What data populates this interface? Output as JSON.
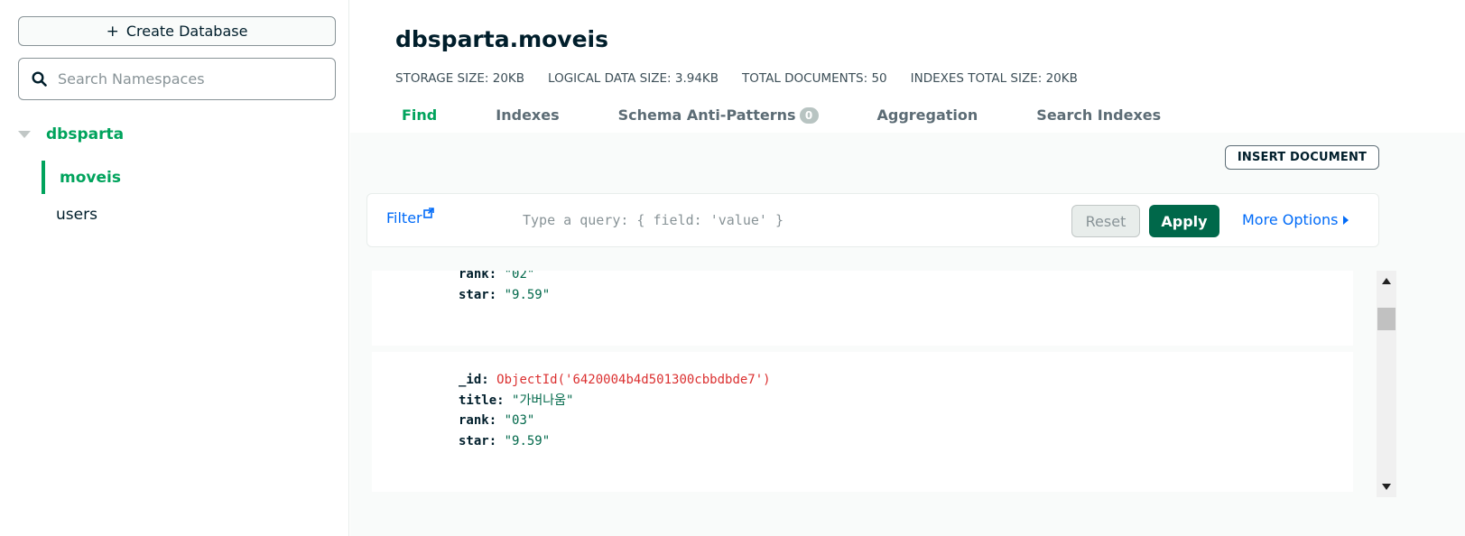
{
  "sidebar": {
    "create_database_icon": "+",
    "create_database_label": "Create Database",
    "search_placeholder": "Search Namespaces",
    "database": "dbsparta",
    "collections": [
      {
        "label": "moveis",
        "active": true
      },
      {
        "label": "users",
        "active": false
      }
    ]
  },
  "header": {
    "title": "dbsparta.moveis",
    "stats": [
      {
        "label": "STORAGE SIZE:",
        "value": "20KB"
      },
      {
        "label": "LOGICAL DATA SIZE:",
        "value": "3.94KB"
      },
      {
        "label": "TOTAL DOCUMENTS:",
        "value": "50"
      },
      {
        "label": "INDEXES TOTAL SIZE:",
        "value": "20KB"
      }
    ],
    "tabs": [
      {
        "label": "Find",
        "active": true
      },
      {
        "label": "Indexes"
      },
      {
        "label": "Schema Anti-Patterns",
        "badge": "0"
      },
      {
        "label": "Aggregation"
      },
      {
        "label": "Search Indexes"
      }
    ]
  },
  "toolbar": {
    "insert_label": "INSERT DOCUMENT",
    "filter_label": "Filter",
    "query_placeholder": "Type a query: { field: 'value' }",
    "reset_label": "Reset",
    "apply_label": "Apply",
    "more_options_label": "More Options"
  },
  "documents": [
    {
      "rank_key": "rank:",
      "rank_value": "\"02\"",
      "star_key": "star:",
      "star_value": "\"9.59\""
    },
    {
      "id_key": "_id:",
      "id_value": "ObjectId('6420004b4d501300cbbdbde7')",
      "title_key": "title:",
      "title_value": "\"가버나움\"",
      "rank_key": "rank:",
      "rank_value": "\"03\"",
      "star_key": "star:",
      "star_value": "\"9.59\""
    }
  ],
  "colors": {
    "accent_green": "#00a35c",
    "apply_green": "#00684a",
    "link_blue": "#016bf8",
    "objectid_red": "#db3030"
  },
  "icons": [
    "plus-icon",
    "search-icon",
    "caret-down-icon",
    "external-link-icon",
    "caret-right-icon"
  ]
}
